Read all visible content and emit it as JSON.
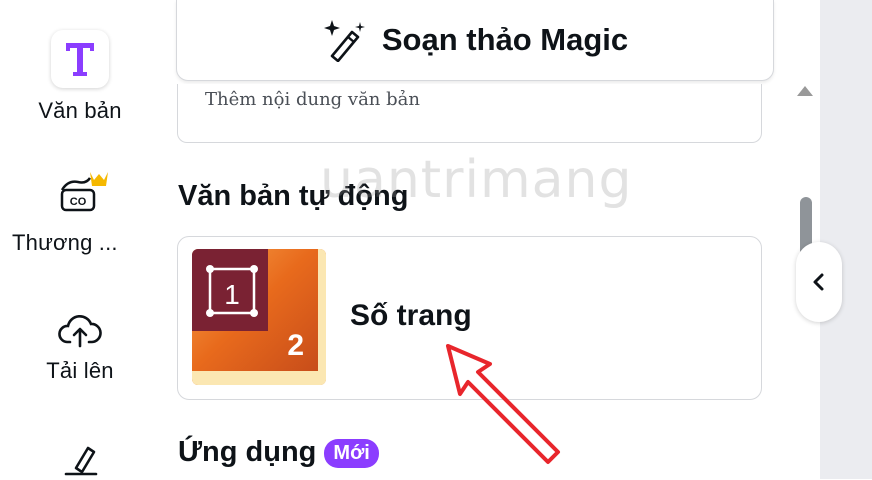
{
  "sidebar": {
    "items": [
      {
        "label": "Văn bản",
        "icon": "text-t-icon"
      },
      {
        "label": "Thương ...",
        "icon": "brand-crown-icon"
      },
      {
        "label": "Tải lên",
        "icon": "cloud-upload-icon"
      },
      {
        "label": "",
        "icon": "draw-pen-icon"
      }
    ]
  },
  "panel": {
    "magic_write_label": "Soạn thảo Magic",
    "text_placeholder": "Thêm nội dung văn bản",
    "auto_text_title": "Văn bản tự động",
    "auto_text_item": {
      "label": "Số trang",
      "thumb_box_number": "1",
      "thumb_page_number": "2"
    },
    "apps_title": "Ứng dụng",
    "apps_badge": "Mới"
  },
  "watermark": "uantrimang",
  "colors": {
    "accent": "#8b3dff",
    "crown": "#f5b800",
    "arrow": "#e8262c"
  }
}
